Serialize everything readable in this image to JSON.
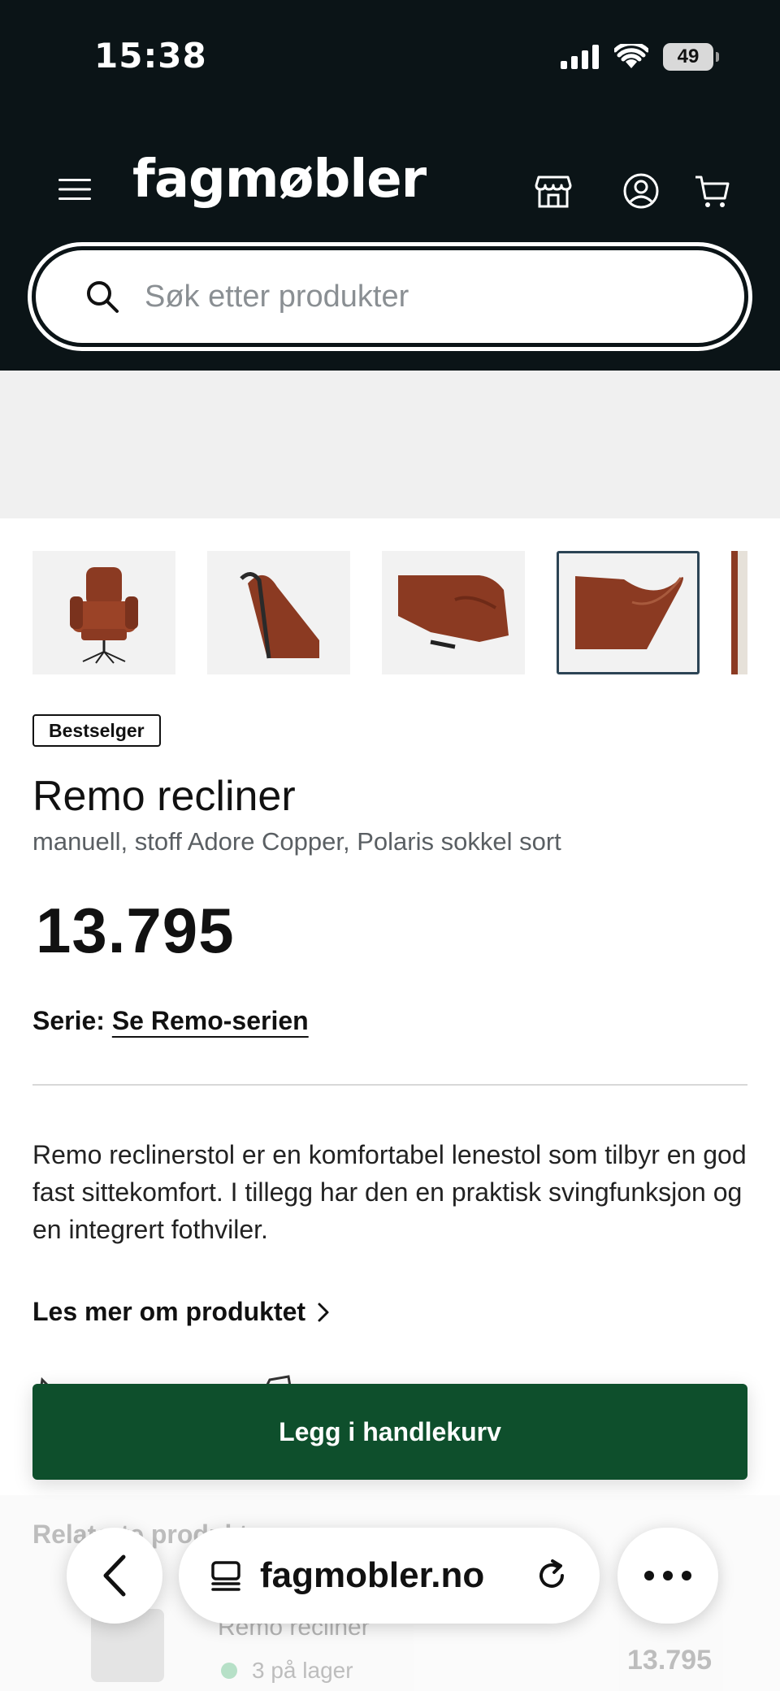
{
  "status_bar": {
    "time": "15:38",
    "battery": "49"
  },
  "header": {
    "logo": "fagmøbler",
    "icons": [
      "menu-icon",
      "store-icon",
      "account-icon",
      "cart-icon"
    ]
  },
  "search": {
    "placeholder": "Søk etter produkter"
  },
  "gallery": {
    "thumbnails": [
      "recliner-front",
      "recliner-side-detail",
      "recliner-armrest-closeup",
      "recliner-seat-closeup",
      "recliner-partial"
    ],
    "selected_index": 3
  },
  "product": {
    "badge": "Bestselger",
    "title": "Remo recliner",
    "subtitle": "manuell, stoff Adore Copper, Polaris sokkel sort",
    "price": "13.795",
    "series_label": "Serie:",
    "series_link": "Se Remo-serien",
    "description": "Remo reclinerstol er en komfortabel lenestol som tilbyr en god fast sittekomfort. I tillegg har den en praktisk svingfunksjon og en integrert fothviler.",
    "read_more": "Les mer om produktet"
  },
  "add_to_cart": {
    "label": "Legg i handlekurv"
  },
  "related": {
    "title": "Relaterte produkter",
    "item_name": "Remo recliner",
    "item_stock": "3 på lager",
    "item_price": "13.795"
  },
  "browser": {
    "url": "fagmobler.no"
  },
  "colors": {
    "header_bg": "#0b1417",
    "cart_button": "#0e4f2c",
    "selected_border": "#2c4455"
  }
}
